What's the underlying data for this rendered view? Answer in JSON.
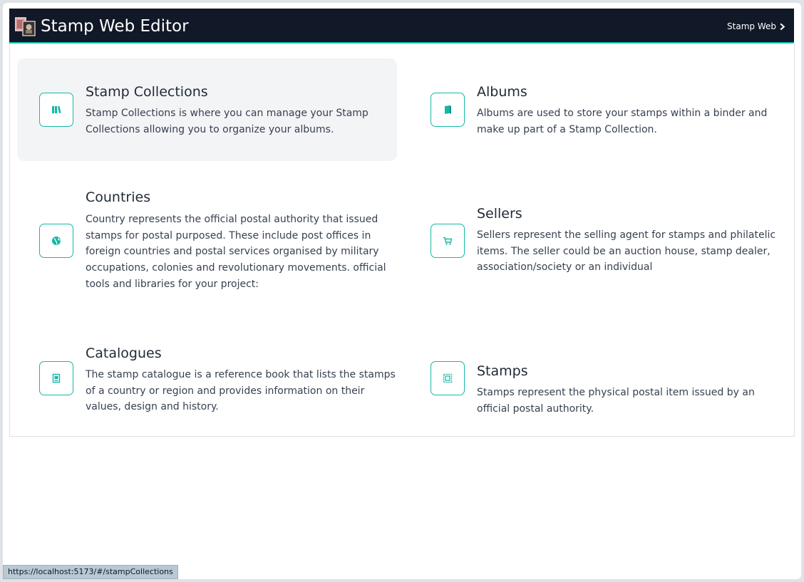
{
  "header": {
    "title": "Stamp Web Editor",
    "nav_link": "Stamp Web"
  },
  "cards": [
    {
      "title": "Stamp Collections",
      "description": "Stamp Collections is where you can manage your Stamp Collections allowing you to organize your albums.",
      "icon": "books-icon",
      "active": true
    },
    {
      "title": "Albums",
      "description": "Albums are used to store your stamps within a binder and make up part of a Stamp Collection.",
      "icon": "book-icon"
    },
    {
      "title": "Countries",
      "description": "Country represents the official postal authority that issued stamps for postal purposed. These include post offices in foreign countries and postal services organised by military occupations, colonies and revolutionary movements. official tools and libraries for your project:",
      "icon": "globe-icon"
    },
    {
      "title": "Sellers",
      "description": "Sellers represent the selling agent for stamps and philatelic items. The seller could be an auction house, stamp dealer, association/society or an individual",
      "icon": "cart-icon"
    },
    {
      "title": "Catalogues",
      "description": "The stamp catalogue is a reference book that lists the stamps of a country or region and provides information on their values, design and history.",
      "icon": "catalogue-icon"
    },
    {
      "title": "Stamps",
      "description": "Stamps represent the physical postal item issued by an official postal authority.",
      "icon": "stamp-icon"
    }
  ],
  "status_bar": {
    "url": "https://localhost:5173/#/stampCollections"
  },
  "colors": {
    "navbar": "#111827",
    "accent": "#14b8a6",
    "active_card": "#f3f4f6"
  }
}
